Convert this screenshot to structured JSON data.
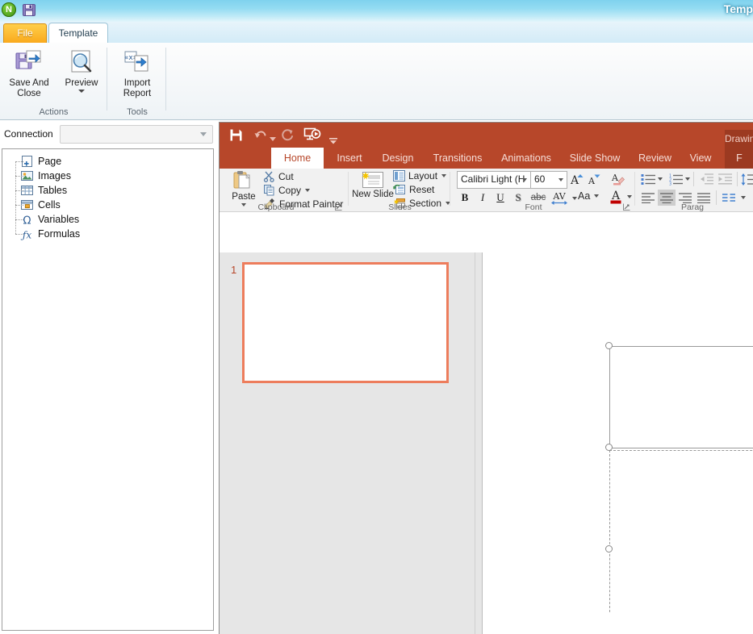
{
  "outer_window": {
    "title": "Temp",
    "quick_access": [
      {
        "name": "nav-logo",
        "icon": "n-logo-icon",
        "label": "N"
      },
      {
        "name": "save-icon",
        "icon": "floppy-save-icon"
      }
    ],
    "tabs": [
      {
        "label": "File",
        "active": false
      },
      {
        "label": "Template",
        "active": true
      }
    ],
    "ribbon_groups": [
      {
        "label": "Actions",
        "buttons": [
          {
            "label": "Save And Close",
            "icon": "save-export-icon",
            "has_dropdown": false
          },
          {
            "label": "Preview",
            "icon": "magnifier-preview-icon",
            "has_dropdown": true
          }
        ]
      },
      {
        "label": "Tools",
        "buttons": [
          {
            "label": "Import Report",
            "icon": "import-report-icon",
            "has_dropdown": false
          }
        ]
      }
    ]
  },
  "connection": {
    "label": "Connection",
    "value": "",
    "placeholder": ""
  },
  "tree": {
    "items": [
      {
        "label": "Page",
        "icon": "page-add-icon"
      },
      {
        "label": "Images",
        "icon": "image-icon"
      },
      {
        "label": "Tables",
        "icon": "table-icon"
      },
      {
        "label": "Cells",
        "icon": "cell-icon"
      },
      {
        "label": "Variables",
        "icon": "omega-variable-icon"
      },
      {
        "label": "Formulas",
        "icon": "fx-formula-icon"
      }
    ]
  },
  "powerpoint": {
    "accent_color": "#b7472a",
    "contextual_accent_color": "#9c3a21",
    "quick_access": [
      {
        "name": "save",
        "icon": "floppy-save-icon"
      },
      {
        "name": "undo",
        "icon": "undo-arrow-icon",
        "has_dropdown": true
      },
      {
        "name": "redo",
        "icon": "redo-arrow-icon"
      },
      {
        "name": "start-from-beginning",
        "icon": "slideshow-screen-icon"
      },
      {
        "name": "customize-quick-access-toolbar",
        "icon": "chevron-down-icon"
      }
    ],
    "tabs": [
      {
        "label": "Home",
        "active": true
      },
      {
        "label": "Insert",
        "active": false
      },
      {
        "label": "Design",
        "active": false
      },
      {
        "label": "Transitions",
        "active": false
      },
      {
        "label": "Animations",
        "active": false
      },
      {
        "label": "Slide Show",
        "active": false
      },
      {
        "label": "Review",
        "active": false
      },
      {
        "label": "View",
        "active": false
      }
    ],
    "contextual": {
      "header": "Drawing Tools",
      "tab": "F"
    },
    "groups": [
      {
        "label": "Clipboard",
        "has_dialog_launcher": true,
        "items": [
          {
            "label": "Paste",
            "icon": "clipboard-paste-icon",
            "has_dropdown": true
          },
          {
            "label": "Cut",
            "icon": "scissors-cut-icon",
            "has_dropdown": false
          },
          {
            "label": "Copy",
            "icon": "copy-pages-icon",
            "has_dropdown": true
          },
          {
            "label": "Format Painter",
            "icon": "paintbrush-format-painter-icon",
            "has_dropdown": false
          }
        ]
      },
      {
        "label": "Slides",
        "has_dialog_launcher": false,
        "items": [
          {
            "label": "New Slide",
            "icon": "new-slide-icon",
            "has_dropdown": true
          },
          {
            "label": "Layout",
            "icon": "layout-icon",
            "has_dropdown": true
          },
          {
            "label": "Reset",
            "icon": "reset-slide-icon",
            "has_dropdown": false
          },
          {
            "label": "Section",
            "icon": "section-icon",
            "has_dropdown": true
          }
        ]
      },
      {
        "label": "Font",
        "has_dialog_launcher": true,
        "font_name": "Calibri Light (H",
        "font_size": "60",
        "items": [
          {
            "name": "increase-font-size",
            "icon": "increase-font-size-icon"
          },
          {
            "name": "decrease-font-size",
            "icon": "decrease-font-size-icon"
          },
          {
            "name": "clear-all-formatting",
            "icon": "clear-formatting-icon"
          },
          {
            "name": "bold",
            "label": "B",
            "icon": "bold-icon"
          },
          {
            "name": "italic",
            "label": "I",
            "icon": "italic-icon"
          },
          {
            "name": "underline",
            "label": "U",
            "icon": "underline-icon"
          },
          {
            "name": "text-shadow",
            "label": "S",
            "icon": "text-shadow-icon"
          },
          {
            "name": "strikethrough",
            "label": "abc",
            "icon": "strikethrough-icon"
          },
          {
            "name": "character-spacing",
            "label": "AV",
            "icon": "character-spacing-icon",
            "has_dropdown": true
          },
          {
            "name": "change-case",
            "label": "Aa",
            "icon": "change-case-icon",
            "has_dropdown": true
          },
          {
            "name": "font-color",
            "label": "A",
            "icon": "font-color-icon",
            "has_dropdown": true
          }
        ]
      },
      {
        "label": "Parag",
        "has_dialog_launcher": false,
        "items": [
          {
            "name": "bullets",
            "icon": "bullet-list-icon",
            "has_dropdown": true
          },
          {
            "name": "numbering",
            "icon": "numbered-list-icon",
            "has_dropdown": true
          },
          {
            "name": "decrease-indent",
            "icon": "decrease-indent-icon"
          },
          {
            "name": "increase-indent",
            "icon": "increase-indent-icon"
          },
          {
            "name": "line-spacing",
            "icon": "line-spacing-icon",
            "has_dropdown": true
          },
          {
            "name": "align-left",
            "icon": "align-left-icon"
          },
          {
            "name": "align-center",
            "icon": "align-center-icon",
            "selected": true
          },
          {
            "name": "align-right",
            "icon": "align-right-icon"
          },
          {
            "name": "justify",
            "icon": "justify-icon"
          },
          {
            "name": "columns",
            "icon": "columns-icon",
            "has_dropdown": true
          }
        ]
      }
    ],
    "slide_pane": {
      "slides": [
        {
          "number": "1",
          "selected": true
        }
      ]
    }
  }
}
